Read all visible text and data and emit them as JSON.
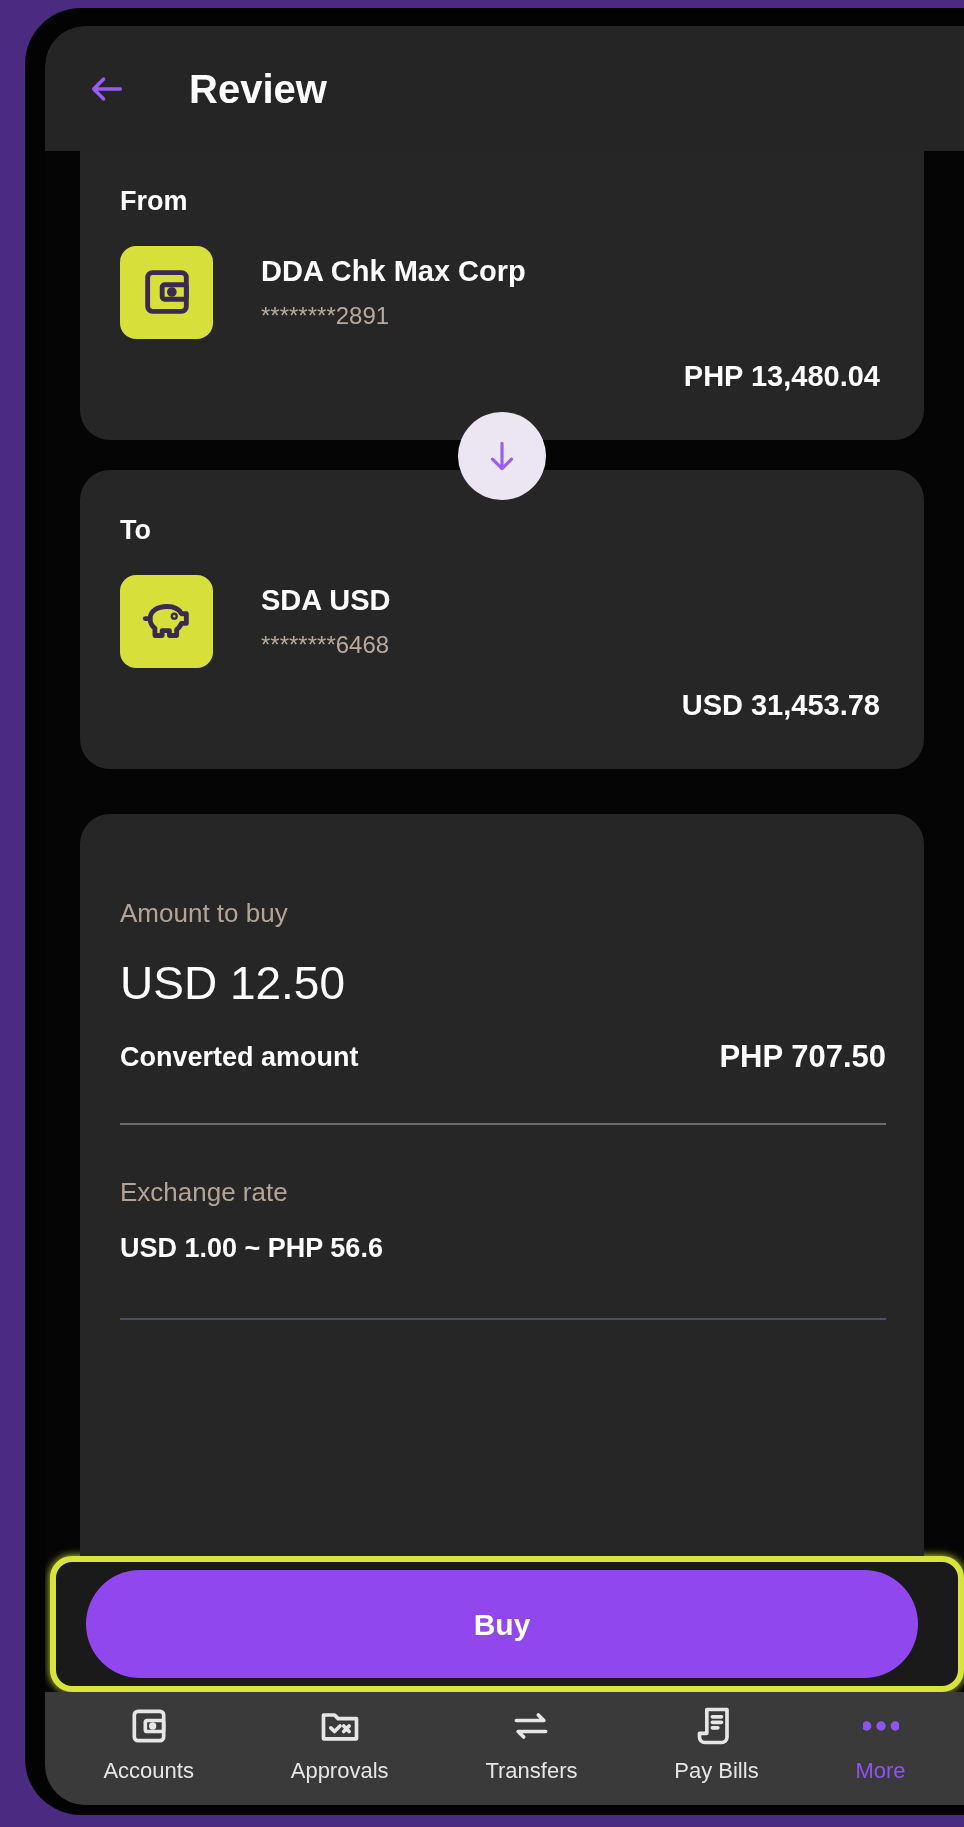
{
  "header": {
    "title": "Review"
  },
  "from": {
    "label": "From",
    "account_name": "DDA Chk Max Corp",
    "account_number": "********2891",
    "balance": "PHP 13,480.04",
    "kind": "wallet"
  },
  "to": {
    "label": "To",
    "account_name": "SDA USD",
    "account_number": "********6468",
    "balance": "USD 31,453.78",
    "kind": "piggy"
  },
  "details": {
    "amount_label": "Amount to buy",
    "amount": "USD 12.50",
    "converted_label": "Converted amount",
    "converted_value": "PHP 707.50",
    "rate_label": "Exchange rate",
    "rate_value": "USD 1.00 ~ PHP 56.6"
  },
  "buy_button": {
    "label": "Buy",
    "highlighted": true
  },
  "nav": [
    {
      "label": "Accounts",
      "kind": "wallet",
      "selected": false
    },
    {
      "label": "Approvals",
      "kind": "approvals",
      "selected": false
    },
    {
      "label": "Transfers",
      "kind": "transfers",
      "selected": false
    },
    {
      "label": "Pay Bills",
      "kind": "bills",
      "selected": false
    },
    {
      "label": "More",
      "kind": "more",
      "selected": true
    }
  ]
}
